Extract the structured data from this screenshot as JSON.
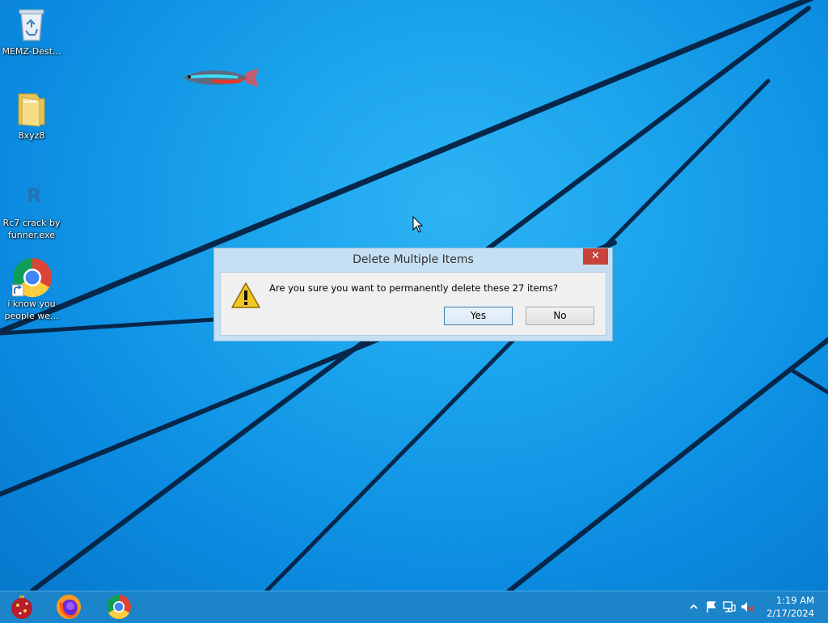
{
  "desktop": {
    "icons": [
      {
        "label": "MEMZ-Dest...",
        "icon": "recycle-bin-icon"
      },
      {
        "label": "8xyz8",
        "icon": "folder-icon"
      },
      {
        "label": "Rc7 crack by funner.exe",
        "label_line1": "Rc7 crack by",
        "label_line2": "funner.exe",
        "icon": "exe-shortcut-icon"
      },
      {
        "label": "i know you people we...",
        "label_line1": "i know you",
        "label_line2": "people we...",
        "icon": "chrome-shortcut-icon"
      }
    ]
  },
  "dialog": {
    "title": "Delete Multiple Items",
    "close_label": "✕",
    "message": "Are you sure you want to permanently delete these 27 items?",
    "yes_label": "Yes",
    "no_label": "No",
    "icon": "warning-icon"
  },
  "taskbar": {
    "apps": [
      {
        "name": "ornament-app-icon"
      },
      {
        "name": "firefox-icon"
      },
      {
        "name": "chrome-icon"
      }
    ],
    "tray": {
      "icons": [
        "show-hidden-icons-chevron",
        "action-center-flag-icon",
        "network-icon",
        "volume-muted-icon"
      ],
      "time": "1:19 AM",
      "date": "2/17/2024"
    }
  },
  "colors": {
    "desktop": "#1aa2ec",
    "taskbar": "#1c84c8",
    "dialog_frame": "#c6dff3",
    "close_button": "#c7433a"
  }
}
